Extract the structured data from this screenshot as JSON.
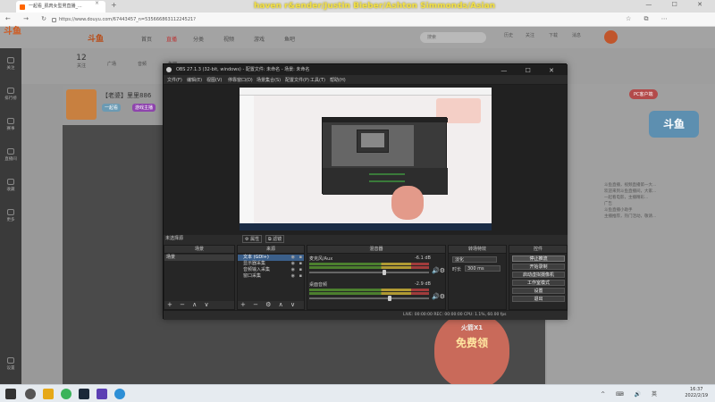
{
  "browser": {
    "tab_title": "一起看_肌肉女型男直播_...",
    "tab_close": "×",
    "new_tab": "+",
    "now_playing": "haven r&ender/Justin Bieber/Ashton Simmonds/Asian",
    "url": "https://www.douyu.com/67443457_n=53566686311224521?",
    "nav_buttons": "← → ↻",
    "window_buttons": "— ☐ ✕",
    "right_icons": "☆ ⧉ ⋯"
  },
  "site": {
    "logo": "斗鱼",
    "logo2": "斗鱼",
    "nav": [
      "首页",
      "直播",
      "分类",
      "视频",
      "游戏",
      "鱼吧"
    ],
    "search_placeholder": "搜索",
    "header_icons": [
      "历史",
      "关注",
      "下载",
      "消息"
    ],
    "left_rail": [
      "关注",
      "排行榜",
      "赛事",
      "直播间",
      "收藏",
      "更多",
      "设置"
    ],
    "subnav": [
      {
        "count": "12",
        "label": "关注"
      },
      {
        "count": "",
        "label": "广场"
      },
      {
        "count": "",
        "label": "音频"
      },
      {
        "count": "",
        "label": "鱼吧"
      }
    ],
    "room_title": "【老婆】里里886",
    "room_tag1": "一起看",
    "room_tag2": "游戏主播",
    "pc_button": "PC客户端",
    "right_logo": "斗鱼",
    "right_text": [
      "斗鱼直播，视频直播第一大...",
      "欢迎来到斗鱼直播间，大家...",
      "一起看电影，主播精彩...",
      "广告",
      "斗鱼直播小助手",
      "主播推荐，热门活动，敬请..."
    ],
    "promo_line1": "火箭X1",
    "promo_line2": "免费领",
    "ad_label": "广告"
  },
  "obs": {
    "title": "OBS 27.1.3 (32-bit, windows) - 配置文件: 未命名 - 场景: 未命名",
    "window_buttons": "— ☐ ✕",
    "menu": [
      "文件(F)",
      "编辑(E)",
      "视图(V)",
      "停靠窗口(D)",
      "场景集合(S)",
      "配置文件(P)",
      "工具(T)",
      "帮助(H)"
    ],
    "scene_selected_label": "未选择源",
    "props_button": "属性",
    "filters_button": "滤镜",
    "dock_scenes": "场景",
    "dock_sources": "来源",
    "dock_mixer": "混音器",
    "dock_transitions": "转场特效",
    "dock_controls": "控件",
    "scenes": [
      "场景"
    ],
    "sources": [
      {
        "name": "文本 (GDI+)",
        "selected": true
      },
      {
        "name": "显示器采集",
        "selected": false
      },
      {
        "name": "音频输入采集",
        "selected": false
      },
      {
        "name": "窗口采集",
        "selected": false
      }
    ],
    "mixer": [
      {
        "name": "麦克风/Aux",
        "db": "-6.1 dB"
      },
      {
        "name": "桌面音频",
        "db": "-2.9 dB"
      }
    ],
    "transition_value": "淡化",
    "duration_label": "时长",
    "duration_value": "300 ms",
    "controls": [
      "停止推流",
      "开始录制",
      "启动虚拟摄像机",
      "工作室模式",
      "设置",
      "退出"
    ],
    "dock_footer": "+ − ∧ ∨",
    "source_footer": "+ − ⚙ ∧ ∨",
    "status": "LIVE: 00:00:00    REC: 00:00:00    CPU: 1.1%, 60.00 fps"
  },
  "taskbar": {
    "time": "16:37",
    "date": "2022/2/19",
    "tray": "^ ⌨ 🔊 英"
  }
}
